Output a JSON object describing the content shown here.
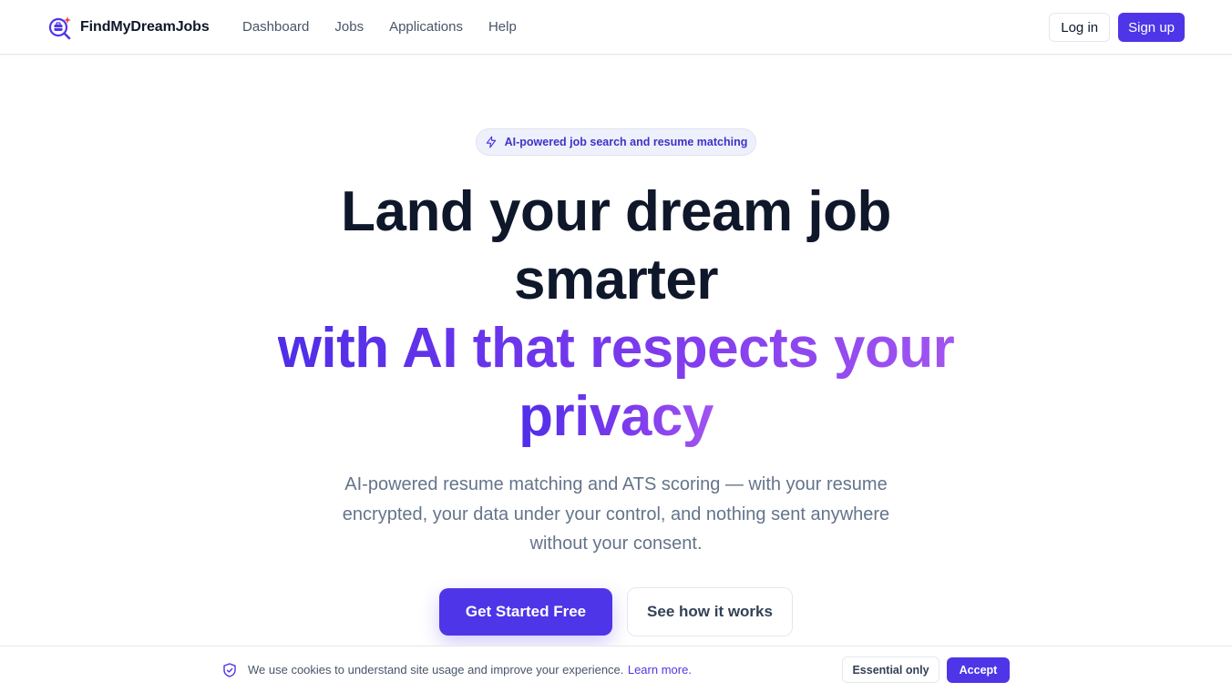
{
  "header": {
    "brand_name": "FindMyDreamJobs",
    "logo_icon": "briefcase-search-icon",
    "nav": [
      "Dashboard",
      "Jobs",
      "Applications",
      "Help"
    ],
    "login_label": "Log in",
    "signup_label": "Sign up"
  },
  "hero": {
    "badge_icon": "lightning-icon",
    "badge_text": "AI-powered job search and resume matching",
    "headline_line1": "Land your dream job",
    "headline_line2": "smarter",
    "headline_accent_line1": "with AI that respects your",
    "headline_accent_line2": "privacy",
    "subtext": "AI-powered resume matching and ATS scoring — with your resume encrypted, your data under your control, and nothing sent anywhere without your consent.",
    "primary_cta": "Get Started Free",
    "secondary_cta": "See how it works"
  },
  "cookie_banner": {
    "icon": "shield-check-icon",
    "message": "We use cookies to understand site usage and improve your experience.",
    "link_text": "Learn more.",
    "essential_label": "Essential only",
    "accept_label": "Accept"
  },
  "colors": {
    "accent": "#4f35e8",
    "accent_gradient_end": "#a155f0",
    "heading": "#0f172a",
    "muted_text": "#64748b"
  }
}
